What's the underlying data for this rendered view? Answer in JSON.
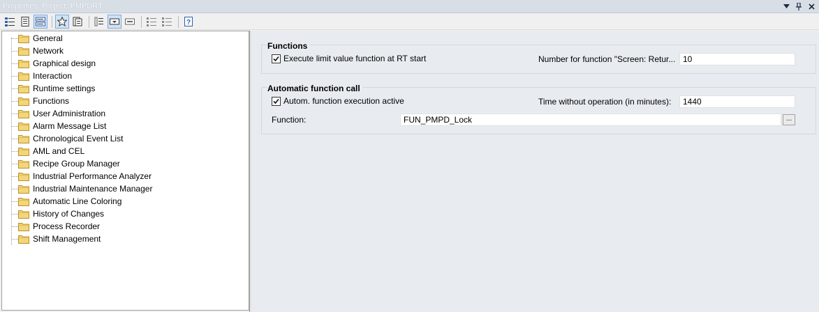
{
  "window": {
    "title": "Properties: Project: PMPDRT"
  },
  "toolbar": {
    "buttons": [
      "categorized",
      "alphabetic",
      "grouped-view",
      "favorites",
      "property-pages",
      "sort",
      "expand",
      "collapse",
      "filter-a",
      "filter-b",
      "help"
    ]
  },
  "tree": {
    "items": [
      "General",
      "Network",
      "Graphical design",
      "Interaction",
      "Runtime settings",
      "Functions",
      "User Administration",
      "Alarm Message List",
      "Chronological Event List",
      "AML and CEL",
      "Recipe Group Manager",
      "Industrial Performance Analyzer",
      "Industrial Maintenance Manager",
      "Automatic Line Coloring",
      "History of Changes",
      "Process Recorder",
      "Shift Management"
    ],
    "selected": "Functions"
  },
  "functions_group": {
    "title": "Functions",
    "checkbox_label": "Execute limit value function at RT start",
    "checkbox_checked": true,
    "number_label": "Number for function \"Screen: Retur...",
    "number_value": "10"
  },
  "auto_group": {
    "title": "Automatic function call",
    "checkbox_label": "Autom. function execution active",
    "checkbox_checked": true,
    "time_label": "Time without operation (in minutes):",
    "time_value": "1440",
    "function_label": "Function:",
    "function_value": "FUN_PMPD_Lock",
    "browse_label": "..."
  }
}
